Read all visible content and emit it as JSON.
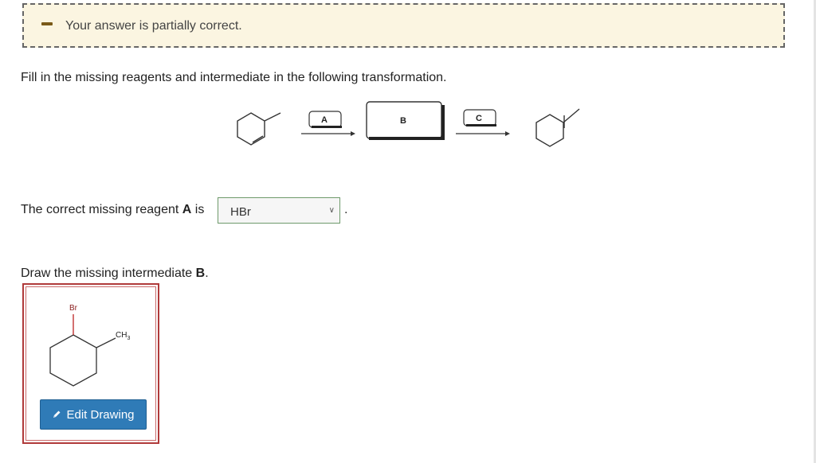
{
  "feedback": {
    "message": "Your answer is partially correct."
  },
  "question": {
    "prompt": "Fill in the missing reagents and intermediate in the following transformation."
  },
  "scheme": {
    "label_a": "A",
    "label_b": "B",
    "label_c": "C"
  },
  "reagent_a": {
    "prefix": "The correct missing reagent ",
    "bold": "A",
    "suffix": " is",
    "selected": "HBr",
    "period": "."
  },
  "intermediate": {
    "prefix": "Draw the missing intermediate ",
    "bold": "B",
    "suffix": ".",
    "atom_br": "Br",
    "atom_ch3": "CH",
    "atom_ch3_sub": "3",
    "edit_label": "Edit Drawing"
  },
  "colors": {
    "feedback_bg": "#fbf5e1",
    "button": "#2f7bb7",
    "frame": "#b03a3a"
  }
}
